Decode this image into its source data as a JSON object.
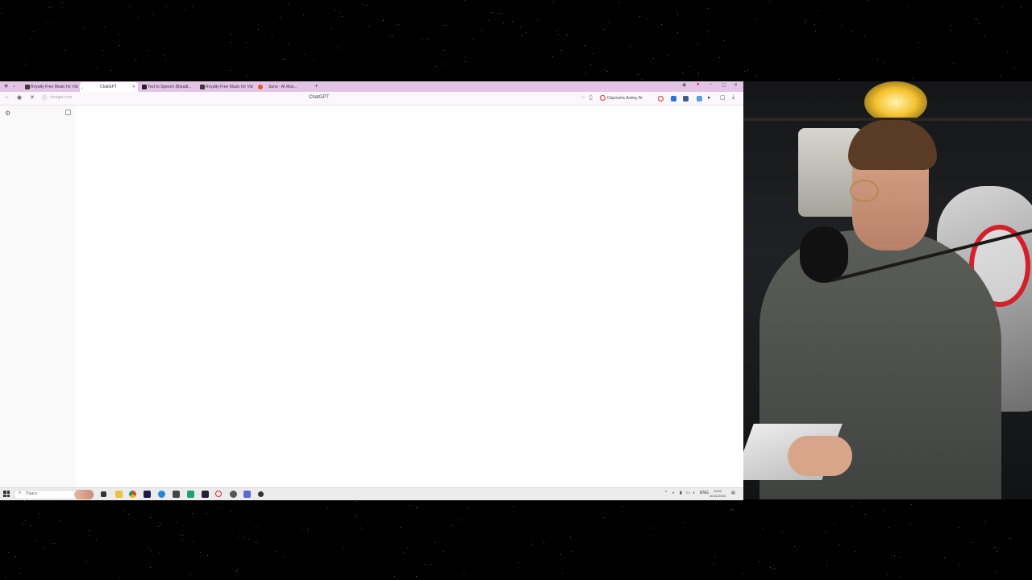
{
  "browser": {
    "tabs": [
      {
        "label": "Royalty Free Music for Vid",
        "active": false
      },
      {
        "label": "ChatGPT",
        "active": true
      },
      {
        "label": "Text to Speech (Beuatl...",
        "active": false
      },
      {
        "label": "Royalty Free Music for Vid",
        "active": false
      },
      {
        "label": "Suno - AI Mus...",
        "active": false
      }
    ],
    "new_tab": "+",
    "window_controls": {
      "minimize": "–",
      "maximize": "▢",
      "close": "✕"
    },
    "url": "chatgpt.com",
    "page_title": "ChatGPT",
    "ask_ai_label": "Спросить Алису AI"
  },
  "taskbar": {
    "search_placeholder": "Поиск",
    "tray_lang": "ENG",
    "clock_time": "13:02",
    "clock_date": "10.02.2024"
  },
  "colors": {
    "tab_strip": "#e3c4e6",
    "taskbar": "#ececec",
    "accent_red": "#e0242b"
  },
  "icons": {
    "tab_favicons": [
      "audiojungle-icon",
      "chatgpt-icon",
      "elevenlabs-icon",
      "audiojungle-icon",
      "suno-icon"
    ],
    "taskbar_apps": [
      "task-view-icon",
      "file-explorer-icon",
      "chrome-icon",
      "premiere-icon",
      "edge-icon",
      "calculator-icon",
      "app-icon",
      "steam-icon",
      "opera-icon",
      "yandex-icon",
      "app-icon",
      "settings-icon"
    ]
  }
}
